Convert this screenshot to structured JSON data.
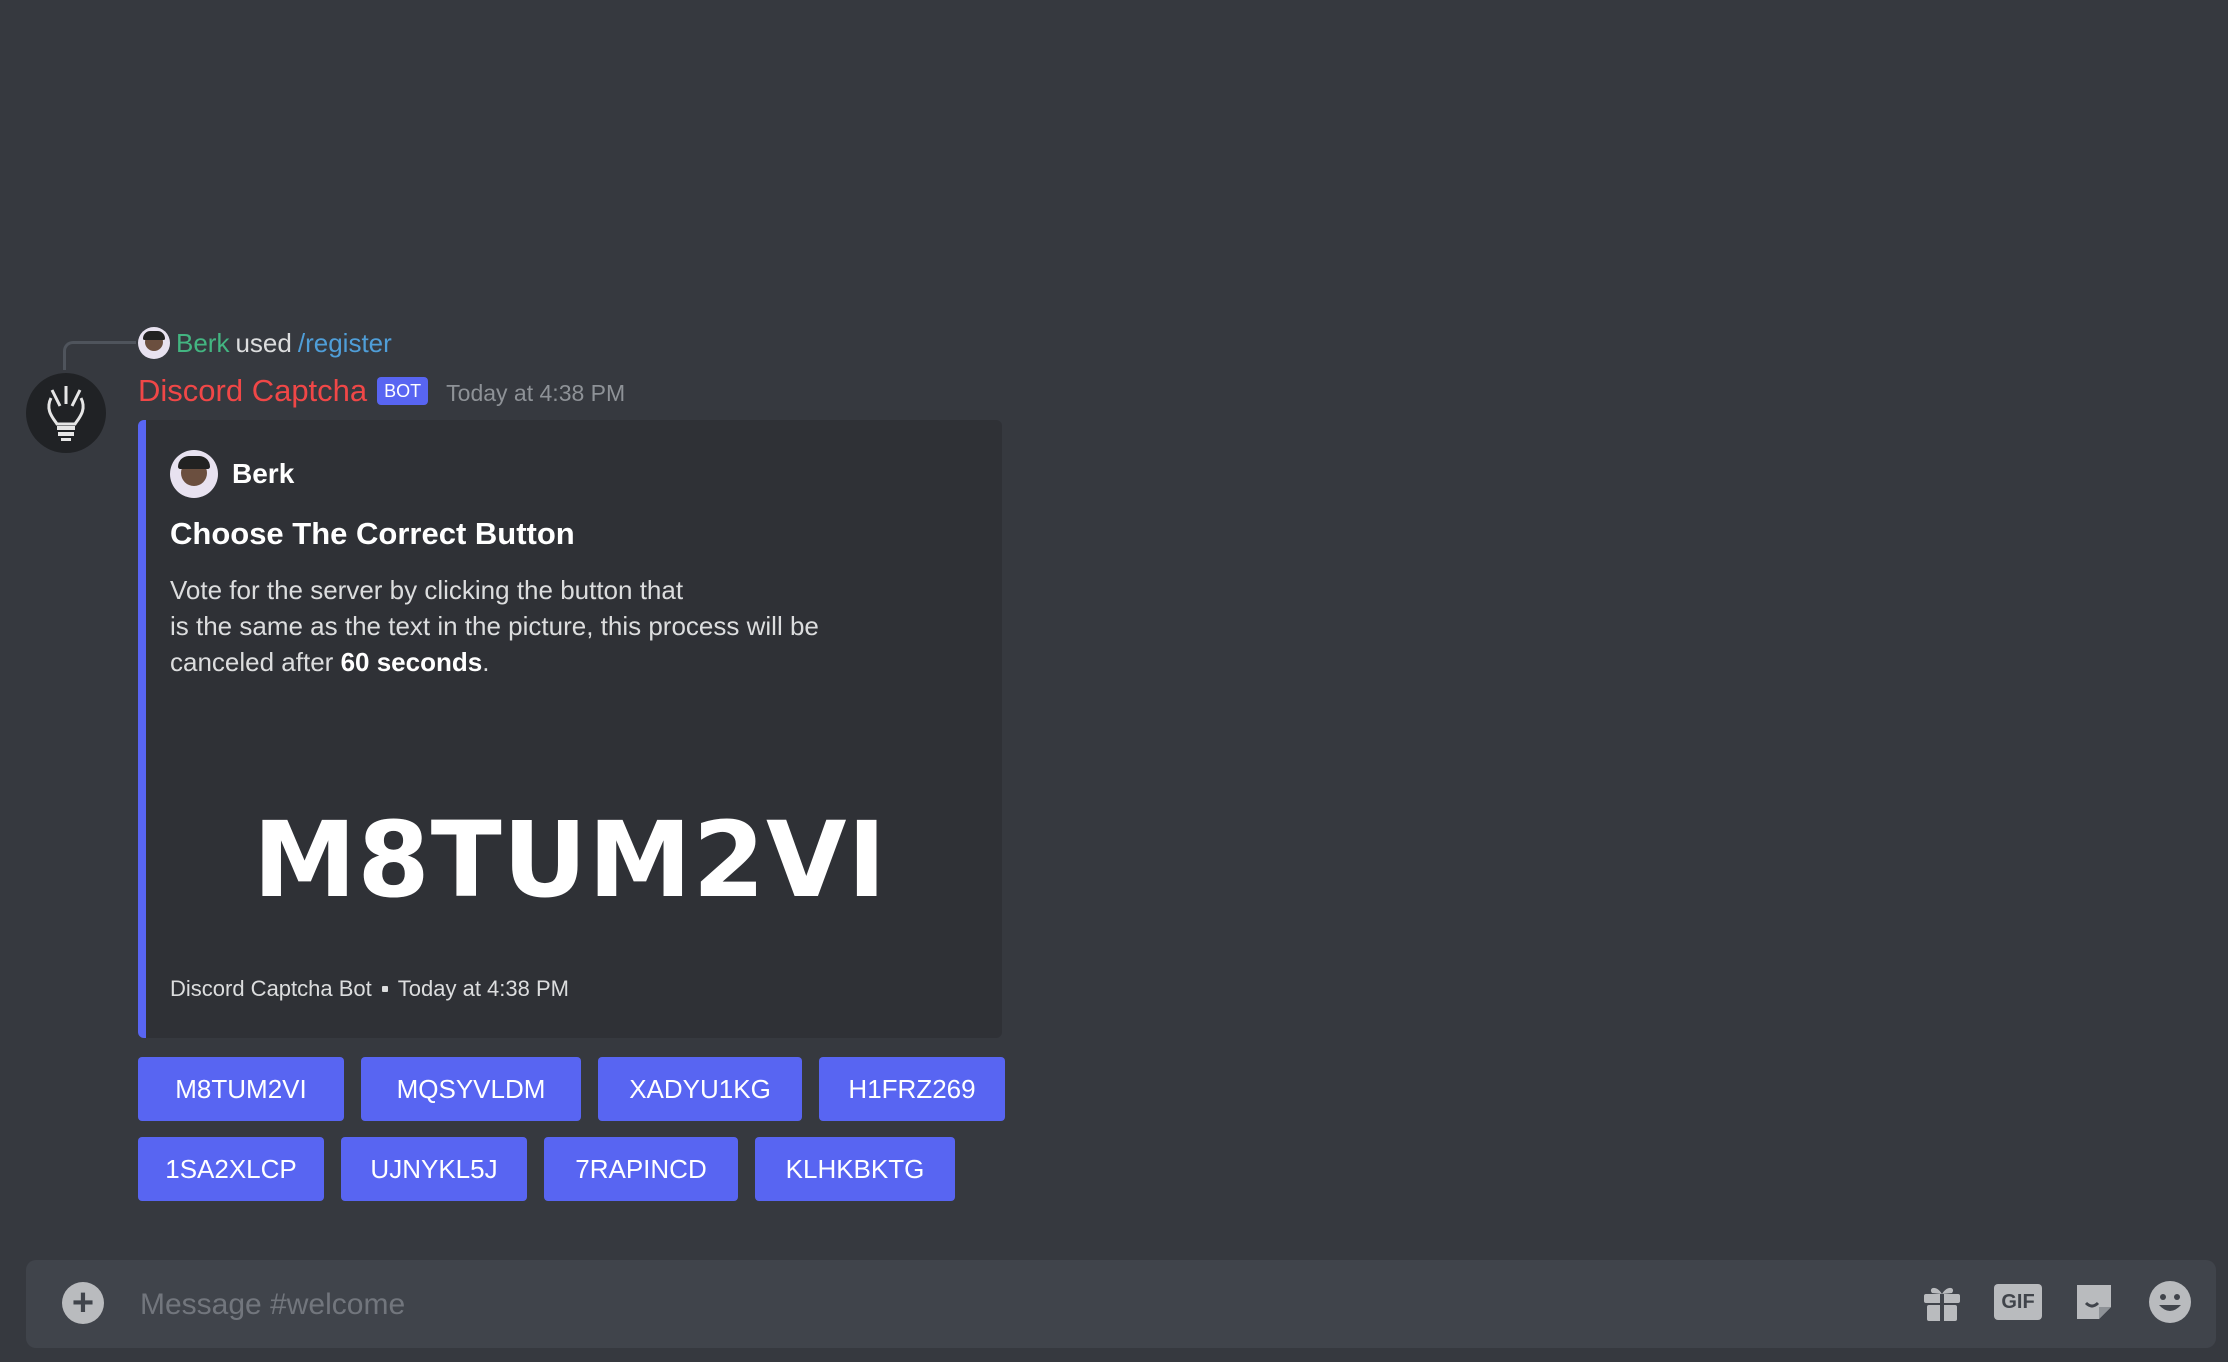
{
  "reply": {
    "user": "Berk",
    "used": "used",
    "command": "/register"
  },
  "message": {
    "author": "Discord Captcha",
    "badge": "BOT",
    "timestamp": "Today at 4:38 PM"
  },
  "embed": {
    "author": "Berk",
    "title": "Choose The Correct Button",
    "description_line1": "Vote for the server by clicking the button that",
    "description_line2": "is the same as the text in the picture, this process will be",
    "description_line3_prefix": "canceled after ",
    "description_line3_bold": "60 seconds",
    "description_line3_suffix": ".",
    "captcha_text": "M8TUM2VI",
    "footer_text": "Discord Captcha Bot",
    "footer_time": "Today at 4:38 PM",
    "accent_color": "#5865f2"
  },
  "buttons": {
    "row1": [
      "M8TUM2VI",
      "MQSYVLDM",
      "XADYU1KG",
      "H1FRZ269"
    ],
    "row2": [
      "1SA2XLCP",
      "UJNYKL5J",
      "7RAPINCD",
      "KLHKBKTG"
    ]
  },
  "composer": {
    "placeholder": "Message #welcome",
    "icons": [
      "add-icon",
      "gift-icon",
      "gif-icon",
      "sticker-icon",
      "emoji-icon"
    ],
    "gif_label": "GIF"
  },
  "colors": {
    "background": "#36393f",
    "bot_name": "#f04747",
    "reply_user": "#43b581",
    "command": "#4f9ed8",
    "blurple": "#5865f2"
  }
}
